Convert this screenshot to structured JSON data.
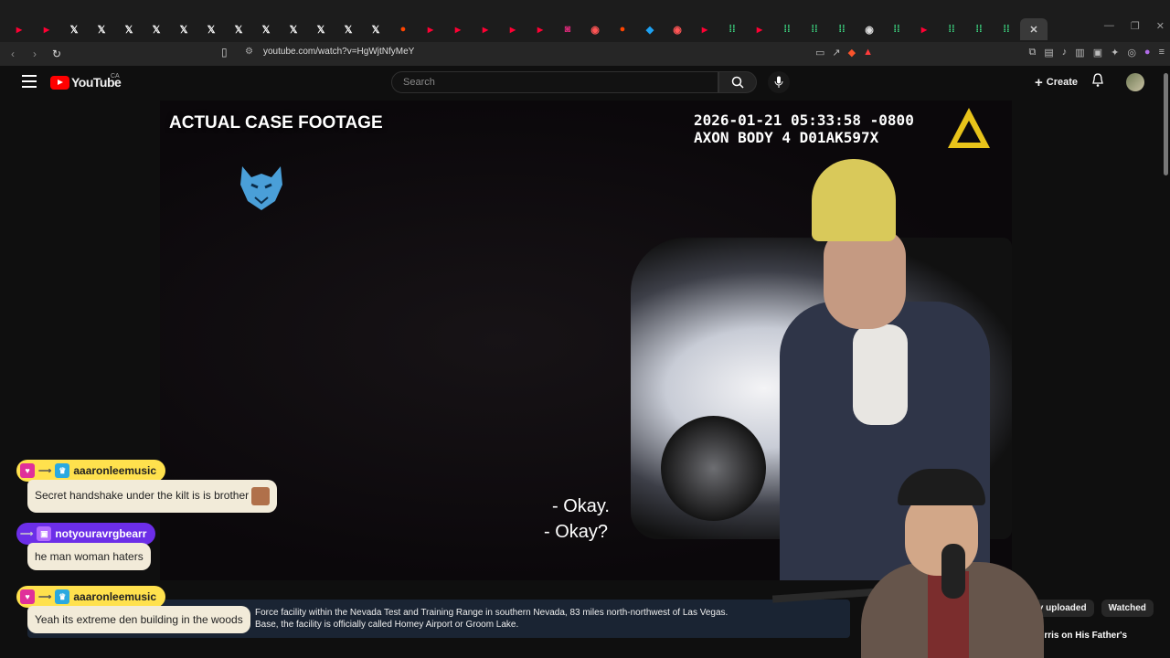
{
  "browser": {
    "tabs": [
      {
        "icon": "yt",
        "color": "#ff0033"
      },
      {
        "icon": "yt",
        "color": "#ff0033"
      },
      {
        "icon": "x",
        "color": "#ffffff"
      },
      {
        "icon": "x",
        "color": "#ffffff"
      },
      {
        "icon": "x",
        "color": "#ffffff"
      },
      {
        "icon": "x",
        "color": "#ffffff"
      },
      {
        "icon": "x",
        "color": "#ffffff"
      },
      {
        "icon": "x",
        "color": "#ffffff"
      },
      {
        "icon": "x",
        "color": "#ffffff"
      },
      {
        "icon": "x",
        "color": "#ffffff"
      },
      {
        "icon": "x",
        "color": "#ffffff"
      },
      {
        "icon": "x",
        "color": "#ffffff"
      },
      {
        "icon": "x",
        "color": "#ffffff"
      },
      {
        "icon": "x",
        "color": "#ffffff"
      },
      {
        "icon": "reddit",
        "color": "#ff4500"
      },
      {
        "icon": "yt",
        "color": "#ff0033"
      },
      {
        "icon": "yt",
        "color": "#ff0033"
      },
      {
        "icon": "yt",
        "color": "#ff0033"
      },
      {
        "icon": "yt",
        "color": "#ff0033"
      },
      {
        "icon": "yt",
        "color": "#ff0033"
      },
      {
        "icon": "ig",
        "color": "#d62976"
      },
      {
        "icon": "circle",
        "color": "#ff5555"
      },
      {
        "icon": "reddit",
        "color": "#ff4500"
      },
      {
        "icon": "bird",
        "color": "#1da1f2"
      },
      {
        "icon": "circle",
        "color": "#ff5555"
      },
      {
        "icon": "yt",
        "color": "#ff0033"
      },
      {
        "icon": "grid",
        "color": "#3ddc84"
      },
      {
        "icon": "yt",
        "color": "#ff0033"
      },
      {
        "icon": "grid",
        "color": "#3ddc84"
      },
      {
        "icon": "grid",
        "color": "#3ddc84"
      },
      {
        "icon": "grid",
        "color": "#3ddc84"
      },
      {
        "icon": "circle",
        "color": "#dddddd"
      },
      {
        "icon": "grid",
        "color": "#3ddc84"
      },
      {
        "icon": "yt",
        "color": "#ff0033"
      },
      {
        "icon": "grid",
        "color": "#3ddc84"
      },
      {
        "icon": "grid",
        "color": "#3ddc84"
      },
      {
        "icon": "grid",
        "color": "#3ddc84"
      },
      {
        "icon": "close",
        "color": "#cccccc"
      }
    ],
    "url": "youtube.com/watch?v=HgWjtNfyMeY"
  },
  "youtube": {
    "logo_text": "YouTube",
    "country": "CA",
    "search_placeholder": "Search",
    "create_label": "Create"
  },
  "video": {
    "overlay_title": "ACTUAL CASE FOOTAGE",
    "timestamp": "2026-01-21 05:33:58 -0800",
    "device": "AXON BODY 4 D01AK597X",
    "subtitle_line1": "- Okay.",
    "subtitle_line2": "- Okay?"
  },
  "description": {
    "line1": "Force facility within the Nevada Test and Training Range in southern Nevada, 83 miles north-northwest of Las Vegas.",
    "line2": "Base, the facility is officially called Homey Airport or Groom Lake."
  },
  "filters": [
    "ently uploaded",
    "Watched"
  ],
  "recommendation_title": "Norris on His Father's",
  "chat": [
    {
      "user": "aaaronleemusic",
      "message": "Secret handshake under the kilt is is brother",
      "head_color": "#ffe14d"
    },
    {
      "user": "notyouravrgbearr",
      "message": "he man woman haters",
      "head_color": "#6c2ee8"
    },
    {
      "user": "aaaronleemusic",
      "message": "Yeah its extreme den building in the woods",
      "head_color": "#ffe14d"
    }
  ]
}
